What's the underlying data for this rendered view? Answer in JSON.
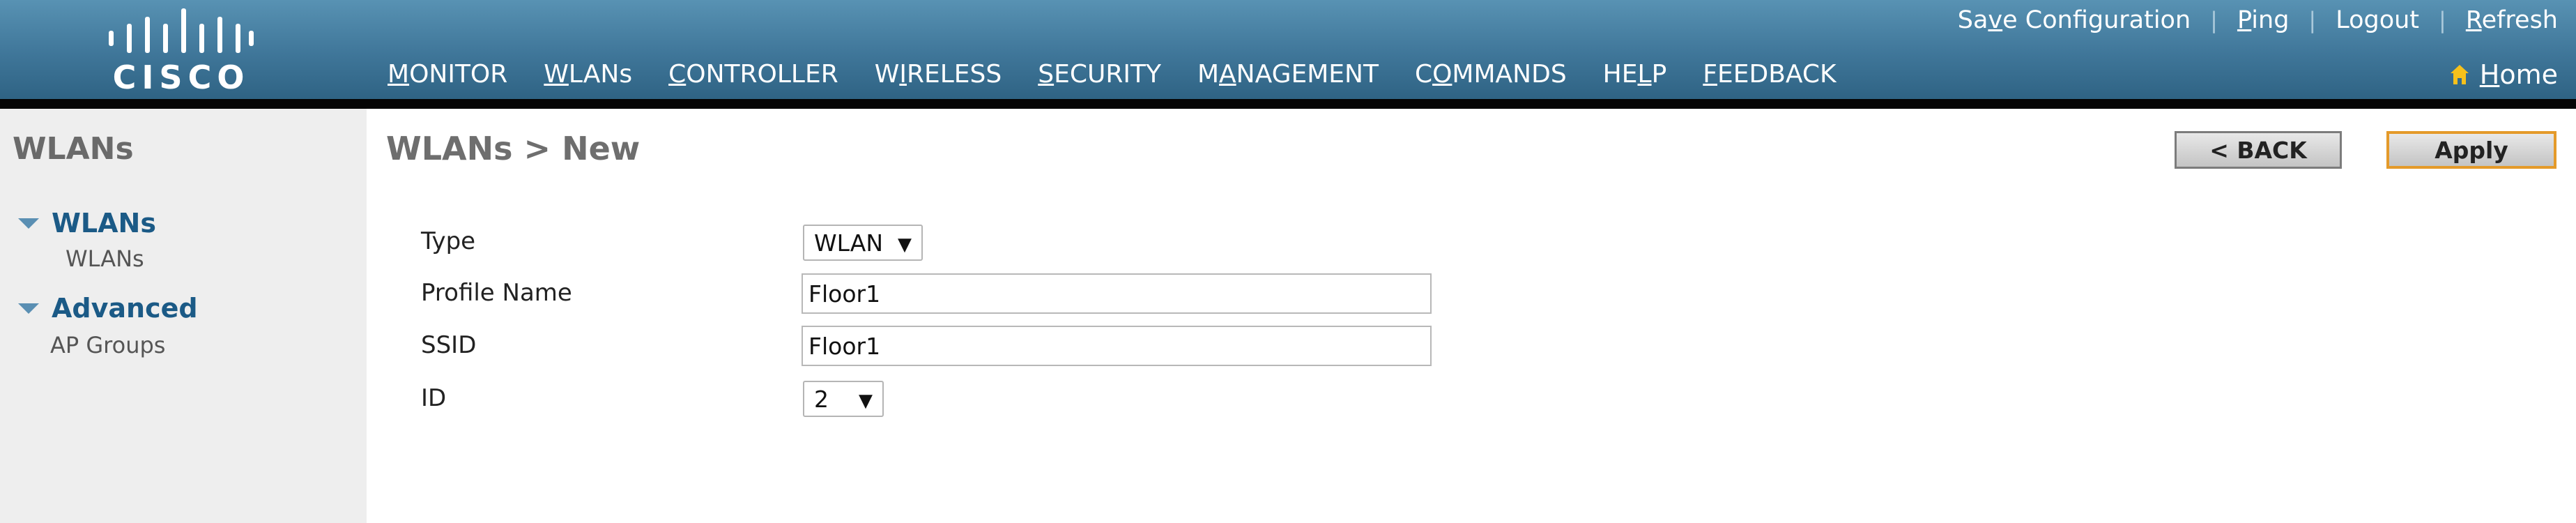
{
  "brand": {
    "logo_text": "CISCO"
  },
  "top_links": [
    {
      "pre": "Sa",
      "key": "v",
      "post": "e Configuration"
    },
    {
      "pre": "",
      "key": "P",
      "post": "ing"
    },
    {
      "pre": "Logout",
      "key": "",
      "post": ""
    },
    {
      "pre": "",
      "key": "R",
      "post": "efresh"
    }
  ],
  "nav": {
    "items": [
      {
        "pre": "",
        "key": "M",
        "post": "ONITOR",
        "active": false
      },
      {
        "pre": "",
        "key": "W",
        "post": "LANs",
        "active": true
      },
      {
        "pre": "",
        "key": "C",
        "post": "ONTROLLER",
        "active": false
      },
      {
        "pre": "W",
        "key": "I",
        "post": "RELESS",
        "active": false
      },
      {
        "pre": "",
        "key": "S",
        "post": "ECURITY",
        "active": false
      },
      {
        "pre": "M",
        "key": "A",
        "post": "NAGEMENT",
        "active": false
      },
      {
        "pre": "C",
        "key": "O",
        "post": "MMANDS",
        "active": false
      },
      {
        "pre": "HE",
        "key": "L",
        "post": "P",
        "active": false
      },
      {
        "pre": "",
        "key": "F",
        "post": "EEDBACK",
        "active": false
      }
    ],
    "home": {
      "pre": "",
      "key": "H",
      "post": "ome"
    }
  },
  "sidebar": {
    "title": "WLANs",
    "groups": [
      {
        "label": "WLANs",
        "sub": "WLANs"
      },
      {
        "label": "Advanced",
        "sub": "AP Groups"
      }
    ]
  },
  "main": {
    "title": "WLANs > New",
    "back_label": "< BACK",
    "apply_label": "Apply"
  },
  "form": {
    "type_label": "Type",
    "type_value": "WLAN",
    "profile_label": "Profile Name",
    "profile_value": "Floor1",
    "ssid_label": "SSID",
    "ssid_value": "Floor1",
    "id_label": "ID",
    "id_value": "2"
  },
  "colors": {
    "header_blue": "#3f7699",
    "active_tab": "#f39a1d",
    "sidebar_link": "#1b5a86",
    "apply_border": "#e49a2a"
  },
  "icons": {
    "home": "home-icon",
    "dropdown": "dropdown-arrow-icon"
  }
}
